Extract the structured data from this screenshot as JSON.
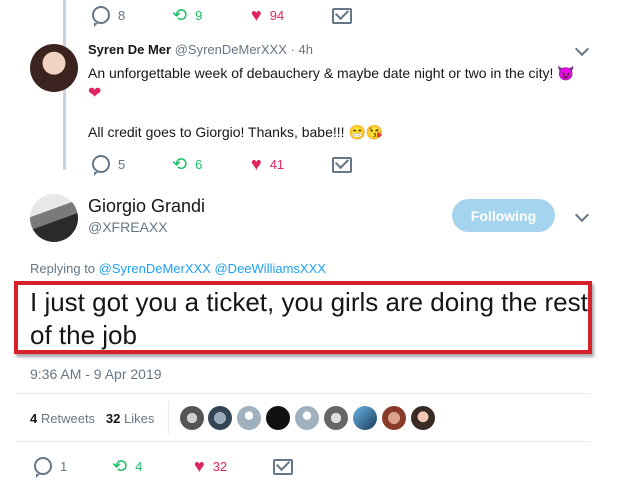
{
  "top_tweet_actions": {
    "replies": "8",
    "retweets": "9",
    "likes": "94"
  },
  "reply_tweet": {
    "name": "Syren De Mer",
    "handle": "@SyrenDeMerXXX",
    "time": "· 4h",
    "text_line1": "An unforgettable week of debauchery & maybe date night or two in the city!",
    "text_line2": "All credit goes to Giorgio! Thanks, babe!!!",
    "emoji1": "😈",
    "emoji2": "❤",
    "emoji3": "😁",
    "emoji4": "😘",
    "replies": "5",
    "retweets": "6",
    "likes": "41"
  },
  "main_tweet": {
    "name": "Giorgio Grandi",
    "handle": "@XFREAXX",
    "follow_label": "Following",
    "replying_prefix": "Replying to",
    "replying_to_1": "@SyrenDeMerXXX",
    "replying_to_2": "@DeeWilliamsXXX",
    "text": "I just got you a ticket, you girls are doing the rest of the job",
    "timestamp": "9:36 AM - 9 Apr 2019",
    "retweet_count": "4",
    "retweet_label": "Retweets",
    "like_count": "32",
    "like_label": "Likes",
    "replies": "1",
    "retweets": "4",
    "likes": "32"
  },
  "colors": {
    "link": "#1da1f2",
    "like": "#e0245e",
    "retweet": "#17bf63",
    "highlight_box": "#d6202a",
    "follow_button": "#a5d4ef"
  },
  "icons": [
    "reply-icon",
    "retweet-icon",
    "heart-icon",
    "mail-icon",
    "chevron-down-icon"
  ]
}
